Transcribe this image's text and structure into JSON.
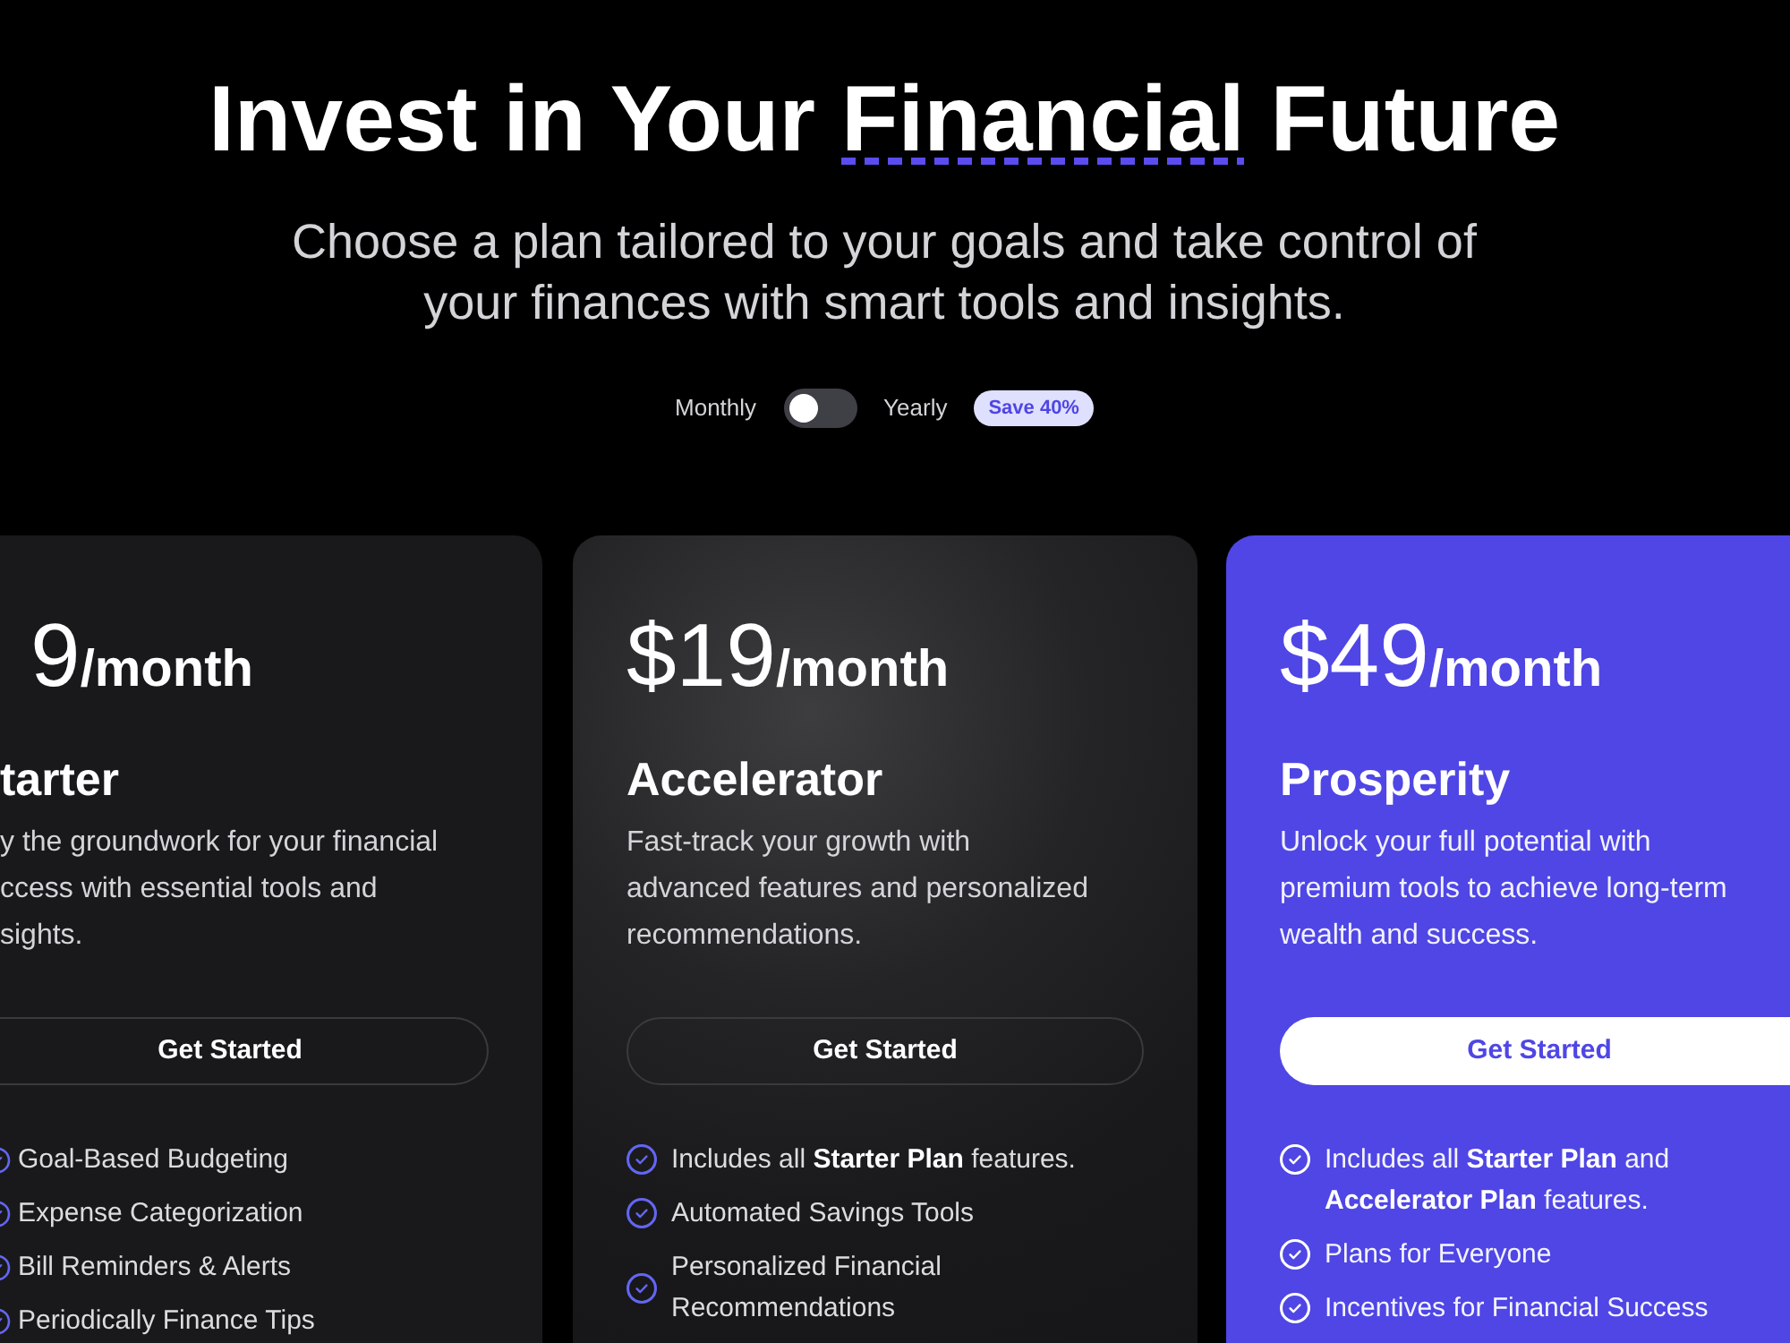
{
  "hero": {
    "title_parts": [
      {
        "text": "Invest in Your ",
        "underlined": false
      },
      {
        "text": "Financial",
        "underlined": true
      },
      {
        "text": " Future",
        "underlined": false
      }
    ],
    "subtitle": "Choose a plan tailored to your goals and take control of your finances with smart tools and insights."
  },
  "billing_toggle": {
    "left_label": "Monthly",
    "on": false,
    "right_label": "Yearly",
    "badge": "Save 40%"
  },
  "plans": [
    {
      "price": "9",
      "period": "/month",
      "name": "tarter",
      "description_lines": [
        "y the groundwork for your financial",
        "ccess with essential tools and",
        "sights."
      ],
      "button": "Get Started",
      "features": [
        "Goal-Based Budgeting",
        "Expense Categorization",
        "Bill Reminders & Alerts",
        "Periodically Finance Tips"
      ],
      "highlighted": false,
      "hovered": false
    },
    {
      "price": "$19",
      "period": "/month",
      "name": "Accelerator",
      "description_lines": [
        "Fast-track your growth with",
        "advanced features and personalized",
        "recommendations."
      ],
      "button": "Get Started",
      "features": [
        "Includes all **Starter Plan** features.",
        "Automated Savings Tools",
        "Personalized Financial Recommendations"
      ],
      "highlighted": false,
      "hovered": true
    },
    {
      "price": "$49",
      "period": "/month",
      "name": "Prosperity",
      "description_lines": [
        "Unlock your full potential with",
        "premium tools to achieve long-term",
        "wealth and success."
      ],
      "button": "Get Started",
      "features": [
        "Includes all **Starter Plan** and **Accelerator Plan** features.",
        "Plans for Everyone",
        "Incentives for Financial Success"
      ],
      "highlighted": true,
      "hovered": false
    }
  ]
}
